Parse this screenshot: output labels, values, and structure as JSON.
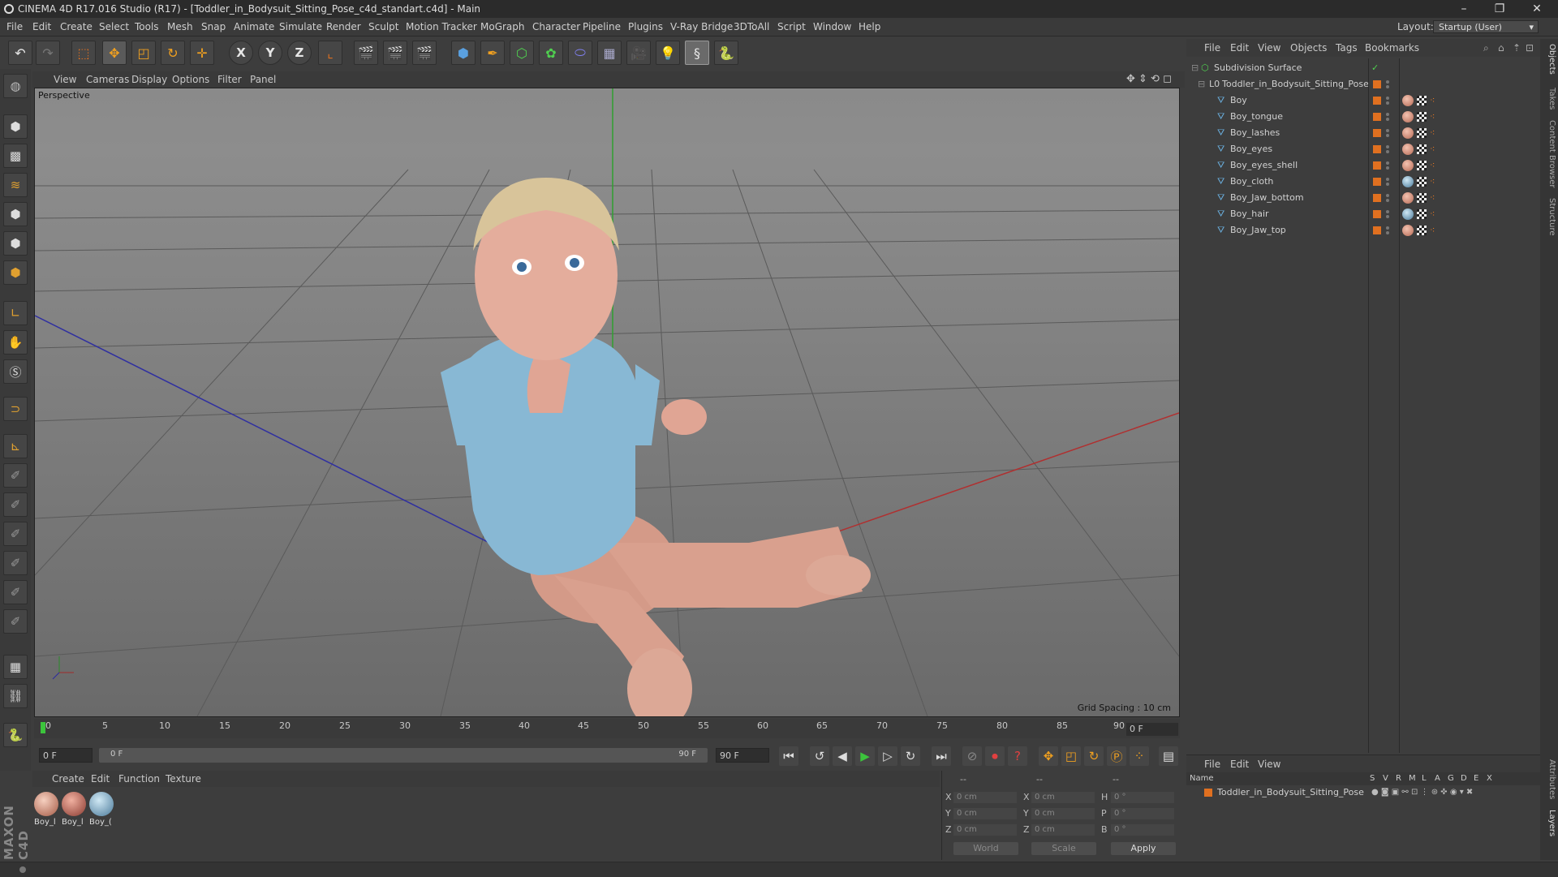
{
  "window": {
    "title": "CINEMA 4D R17.016 Studio (R17) - [Toddler_in_Bodysuit_Sitting_Pose_c4d_standart.c4d] - Main",
    "minimize": "–",
    "restore": "❐",
    "close": "✕"
  },
  "menu": [
    "File",
    "Edit",
    "Create",
    "Select",
    "Tools",
    "Mesh",
    "Snap",
    "Animate",
    "Simulate",
    "Render",
    "Sculpt",
    "Motion Tracker",
    "MoGraph",
    "Character",
    "Pipeline",
    "Plugins",
    "V-Ray Bridge",
    "3DToAll",
    "Script",
    "Window",
    "Help"
  ],
  "layout": {
    "label": "Layout:",
    "value": "Startup (User)"
  },
  "toolbar": {
    "undo": "↶",
    "redo": "↷",
    "axis_x": "X",
    "axis_y": "Y",
    "axis_z": "Z"
  },
  "viewport": {
    "menu": [
      "View",
      "Cameras",
      "Display",
      "Options",
      "Filter",
      "Panel"
    ],
    "label": "Perspective",
    "grid_spacing": "Grid Spacing : 10 cm"
  },
  "timeline": {
    "ticks": [
      "0",
      "5",
      "10",
      "15",
      "20",
      "25",
      "30",
      "35",
      "40",
      "45",
      "50",
      "55",
      "60",
      "65",
      "70",
      "75",
      "80",
      "85",
      "90"
    ],
    "current_frame": "0 F",
    "start_field": "0 F",
    "range_start": "0 F",
    "range_end": "90 F",
    "end_field": "90 F"
  },
  "materials": {
    "menu": [
      "Create",
      "Edit",
      "Function",
      "Texture"
    ],
    "items": [
      {
        "label": "Boy_l"
      },
      {
        "label": "Boy_l"
      },
      {
        "label": "Boy_("
      }
    ]
  },
  "coordinates": {
    "header": [
      "--",
      "--",
      "--"
    ],
    "rows": [
      {
        "a": "X",
        "av": "0 cm",
        "b": "X",
        "bv": "0 cm",
        "c": "H",
        "cv": "0 °"
      },
      {
        "a": "Y",
        "av": "0 cm",
        "b": "Y",
        "bv": "0 cm",
        "c": "P",
        "cv": "0 °"
      },
      {
        "a": "Z",
        "av": "0 cm",
        "b": "Z",
        "bv": "0 cm",
        "c": "B",
        "cv": "0 °"
      }
    ],
    "world": "World",
    "scale": "Scale",
    "apply": "Apply"
  },
  "objects": {
    "menu": [
      "File",
      "Edit",
      "View",
      "Objects",
      "Tags",
      "Bookmarks"
    ],
    "root": "Subdivision Surface",
    "group": "Toddler_in_Bodysuit_Sitting_Pose",
    "children": [
      "Boy",
      "Boy_tongue",
      "Boy_lashes",
      "Boy_eyes",
      "Boy_eyes_shell",
      "Boy_cloth",
      "Boy_Jaw_bottom",
      "Boy_hair",
      "Boy_Jaw_top"
    ]
  },
  "layers": {
    "menu": [
      "File",
      "Edit",
      "View"
    ],
    "columns": [
      "Name",
      "S",
      "V",
      "R",
      "M",
      "L",
      "A",
      "G",
      "D",
      "E",
      "X"
    ],
    "row": "Toddler_in_Bodysuit_Sitting_Pose"
  },
  "right_tabs": [
    "Objects",
    "Takes",
    "Content Browser",
    "Structure",
    "Attributes",
    "Layers"
  ],
  "colors": {
    "accent": "#e07020",
    "play": "#3cc43c"
  }
}
